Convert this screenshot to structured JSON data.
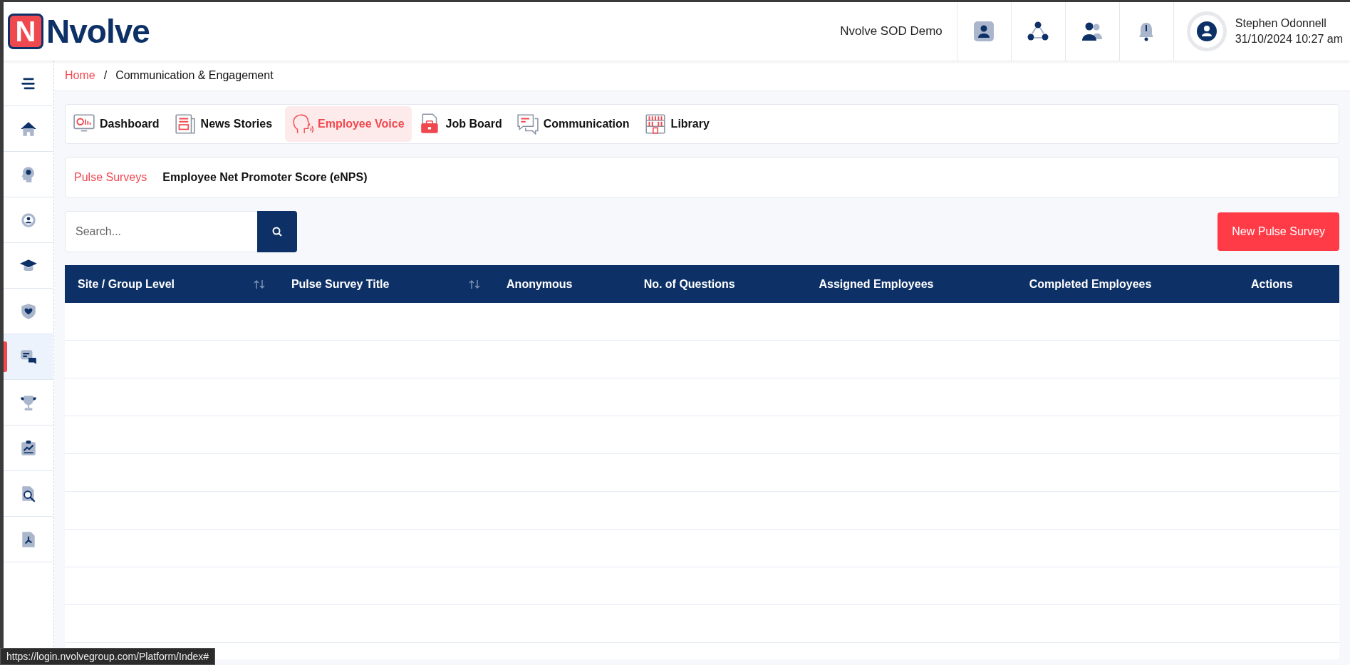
{
  "header": {
    "logo": {
      "mark": "N",
      "text": "Nvolve"
    },
    "org": "Nvolve SOD Demo",
    "actions": [
      {
        "kind": "profile"
      },
      {
        "kind": "network"
      },
      {
        "kind": "users"
      },
      {
        "kind": "bell"
      }
    ],
    "user": {
      "name": "Stephen Odonnell",
      "datetime": "31/10/2024 10:27 am"
    }
  },
  "sidebar": {
    "items": [
      {
        "kind": "menu",
        "selected": false
      },
      {
        "kind": "home",
        "selected": false
      },
      {
        "kind": "head",
        "selected": false
      },
      {
        "kind": "gear",
        "selected": false
      },
      {
        "kind": "cap",
        "selected": false
      },
      {
        "kind": "shield",
        "selected": false
      },
      {
        "kind": "chat",
        "selected": true
      },
      {
        "kind": "trophy",
        "selected": false
      },
      {
        "kind": "chart",
        "selected": false
      },
      {
        "kind": "search",
        "selected": false
      },
      {
        "kind": "pdf",
        "selected": false
      }
    ]
  },
  "breadcrumb": {
    "items": [
      "Home",
      "Communication & Engagement"
    ],
    "separator": "/"
  },
  "tabs": [
    {
      "label": "Dashboard",
      "kind": "dashboard",
      "selected": false
    },
    {
      "label": "News Stories",
      "kind": "news",
      "selected": false
    },
    {
      "label": "Employee Voice",
      "kind": "voice",
      "selected": true
    },
    {
      "label": "Job Board",
      "kind": "job",
      "selected": false
    },
    {
      "label": "Communication",
      "kind": "communication",
      "selected": false
    },
    {
      "label": "Library",
      "kind": "library",
      "selected": false
    }
  ],
  "subtabs": [
    {
      "label": "Pulse Surveys",
      "selected": true
    },
    {
      "label": "Employee Net Promoter Score (eNPS)",
      "selected": false
    }
  ],
  "search": {
    "placeholder": "Search..."
  },
  "new_button": "New Pulse Survey",
  "table": {
    "columns": [
      {
        "label": "Site / Group Level",
        "sortable": true
      },
      {
        "label": "Pulse Survey Title",
        "sortable": true
      },
      {
        "label": "Anonymous",
        "sortable": false
      },
      {
        "label": "No. of Questions",
        "sortable": false
      },
      {
        "label": "Assigned Employees",
        "sortable": false
      },
      {
        "label": "Completed Employees",
        "sortable": false
      },
      {
        "label": "Actions",
        "sortable": false
      }
    ]
  },
  "status_bar": {
    "url": "https://login.nvolvegroup.com/Platform/Index#"
  }
}
